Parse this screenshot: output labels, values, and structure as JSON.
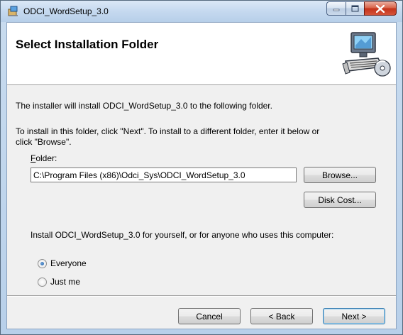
{
  "window": {
    "title": "ODCI_WordSetup_3.0",
    "icons": {
      "app": "installer-icon",
      "minimize": "minimize-icon",
      "maximize": "maximize-icon",
      "close": "close-icon"
    }
  },
  "banner": {
    "title": "Select Installation Folder",
    "art_icon": "computer-cd-icon"
  },
  "body": {
    "intro": "The installer will install ODCI_WordSetup_3.0 to the following folder.",
    "instruction_line1": "To install in this folder, click \"Next\". To install to a different folder, enter it below or",
    "instruction_line2": "click \"Browse\".",
    "folder_label_first": "F",
    "folder_label_rest": "older:",
    "folder_value": "C:\\Program Files (x86)\\Odci_Sys\\ODCI_WordSetup_3.0",
    "browse_label": "Browse...",
    "disk_cost_label": "Disk Cost...",
    "install_for_label": "Install ODCI_WordSetup_3.0 for yourself, or for anyone who uses this computer:",
    "radio_everyone": "Everyone",
    "radio_just_me": "Just me",
    "selected_option": "Everyone"
  },
  "footer": {
    "cancel_label": "Cancel",
    "back_label": "< Back",
    "next_label": "Next >"
  },
  "colors": {
    "titlebar": "#c5d9ef",
    "client": "#f0f0f0",
    "close_button": "#c4321a"
  }
}
